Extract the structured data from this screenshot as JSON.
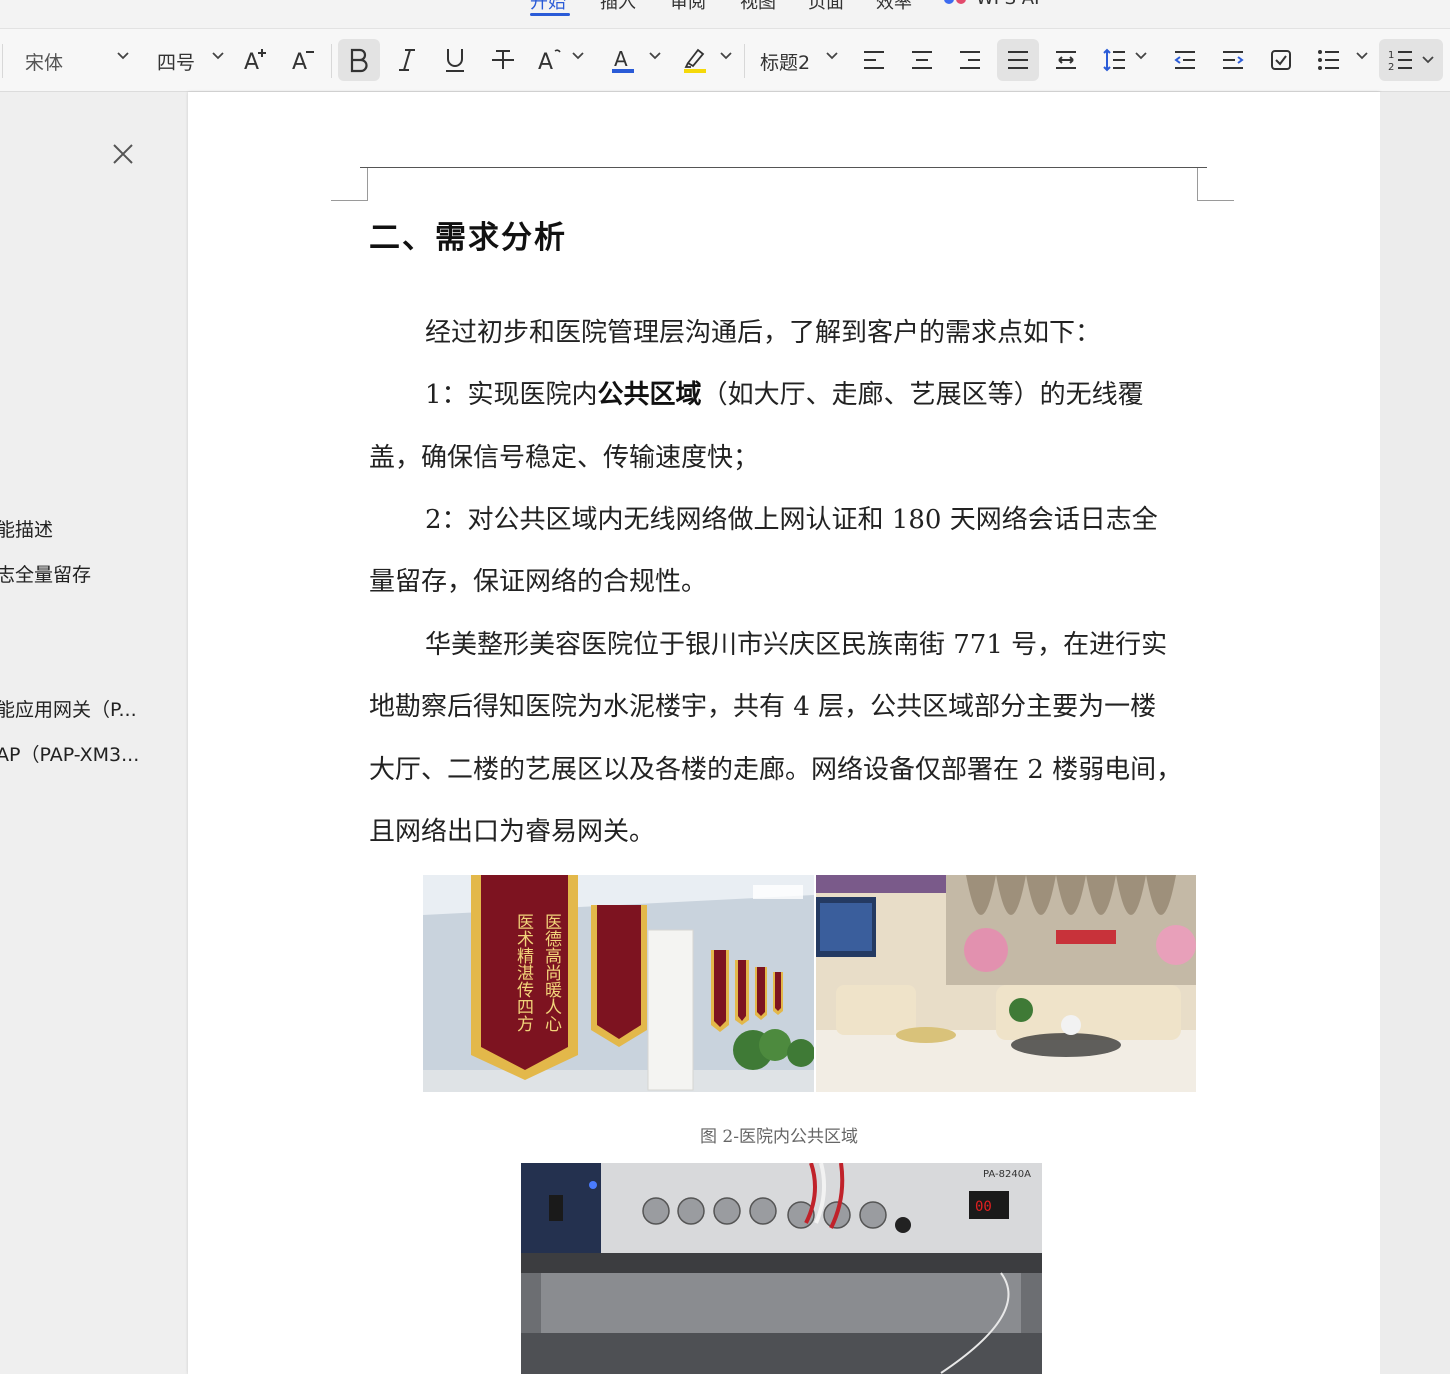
{
  "ribbon": {
    "tabs": [
      "开始",
      "插入",
      "审阅",
      "视图",
      "页面",
      "效率",
      "WPS AI"
    ]
  },
  "toolbar": {
    "font_name": "宋体",
    "font_size": "四号",
    "paragraph_style": "标题2",
    "icons": [
      "grow-font-icon",
      "shrink-font-icon",
      "bold-icon",
      "italic-icon",
      "underline-icon",
      "strikethrough-icon",
      "text-effect-icon",
      "font-color-icon",
      "highlight-icon",
      "align-left-icon",
      "align-center-icon",
      "align-right-icon",
      "justify-icon",
      "distribute-icon",
      "line-spacing-icon",
      "decrease-indent-icon",
      "increase-indent-icon",
      "checkbox-icon",
      "bullet-list-icon",
      "numbered-list-icon"
    ],
    "colors": {
      "font_color": "#2a5bd7",
      "highlight": "#f5d90a"
    }
  },
  "nav": {
    "items": [
      {
        "label": "能描述"
      },
      {
        "label": "志全量留存"
      },
      {
        "label": "能应用网关（P..."
      },
      {
        "label": "AP（PAP-XM3..."
      }
    ]
  },
  "document": {
    "heading": "二、需求分析",
    "p1": "经过初步和医院管理层沟通后，了解到客户的需求点如下：",
    "p2_a": "1：实现医院内",
    "p2_bold": "公共区域",
    "p2_b": "（如大厅、走廊、艺展区等）的无线覆",
    "p2_c": "盖，确保信号稳定、传输速度快；",
    "p3_a": "2：对公共区域内无线网络做上网认证和 180 天网络会话日志全",
    "p3_b": "量留存，保证网络的合规性。",
    "p4_a": "华美整形美容医院位于银川市兴庆区民族南街 771 号，在进行实",
    "p4_b": "地勘察后得知医院为水泥楼宇，共有 4 层，公共区域部分主要为一楼",
    "p4_c": "大厅、二楼的艺展区以及各楼的走廊。网络设备仅部署在 2 楼弱电间，",
    "p4_d": "且网络出口为睿易网关。",
    "figure_caption": "图 2-医院内公共区域",
    "banner_text_1": "医德高尚暖人心",
    "banner_text_2": "医术精湛传四方",
    "amp_model": "PA-8240A"
  }
}
